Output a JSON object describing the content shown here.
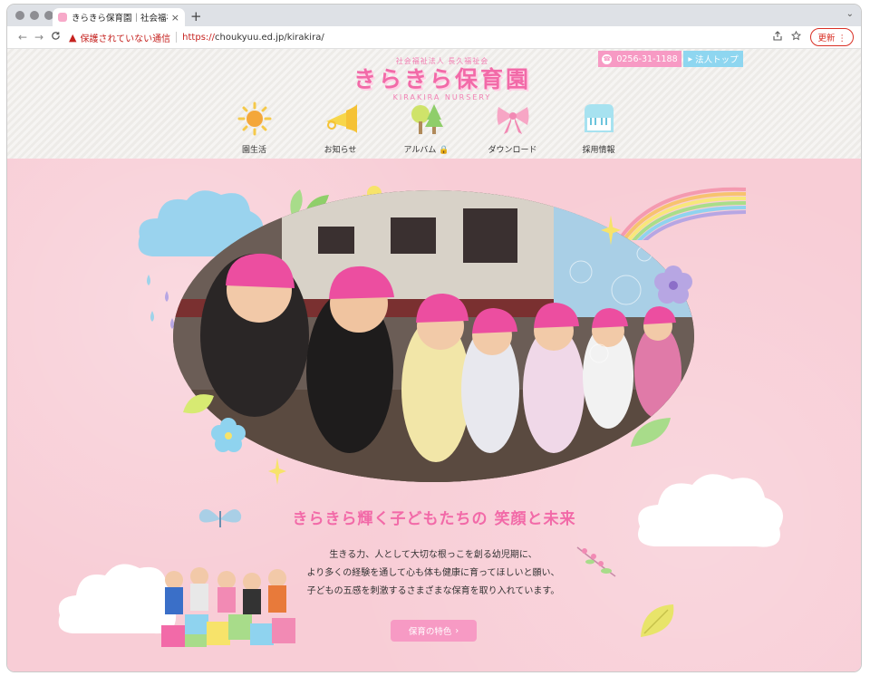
{
  "browser": {
    "tab_title": "きらきら保育園｜社会福祉法人",
    "tab_close": "×",
    "new_tab": "+",
    "tab_menu": "⌄",
    "back": "←",
    "forward": "→",
    "reload": "C",
    "security_label": "保護されていない通信",
    "scheme": "https://",
    "url": "choukyuu.ed.jp/kirakira/",
    "update_label": "更新"
  },
  "header": {
    "corp_name": "社会福祉法人 長久福祉会",
    "logo_text": "きらきら保育園",
    "logo_en": "KIRAKIRA NURSERY",
    "phone": "0256-31-1188",
    "corp_top": "法人トップ",
    "nav": [
      {
        "label": "園生活",
        "icon": "sun-icon"
      },
      {
        "label": "お知らせ",
        "icon": "trumpet-icon"
      },
      {
        "label": "アルバム",
        "icon": "trees-icon"
      },
      {
        "label": "ダウンロード",
        "icon": "ribbon-icon"
      },
      {
        "label": "採用情報",
        "icon": "piano-icon"
      }
    ]
  },
  "hero": {
    "catch": "きらきら輝く子どもたちの 笑顔と未来",
    "desc_lines": [
      "生きる力、人として大切な根っこを創る幼児期に、",
      "より多くの経験を通して心も体も健康に育ってほしいと願い、",
      "子どもの五感を刺激するさまざまな保育を取り入れています。"
    ],
    "feature_button": "保育の特色"
  },
  "colors": {
    "pink": "#f26aa8",
    "pink_light": "#f79ac4",
    "blue_light": "#8ed6f0",
    "hero_bg": "#f8cdd6"
  }
}
